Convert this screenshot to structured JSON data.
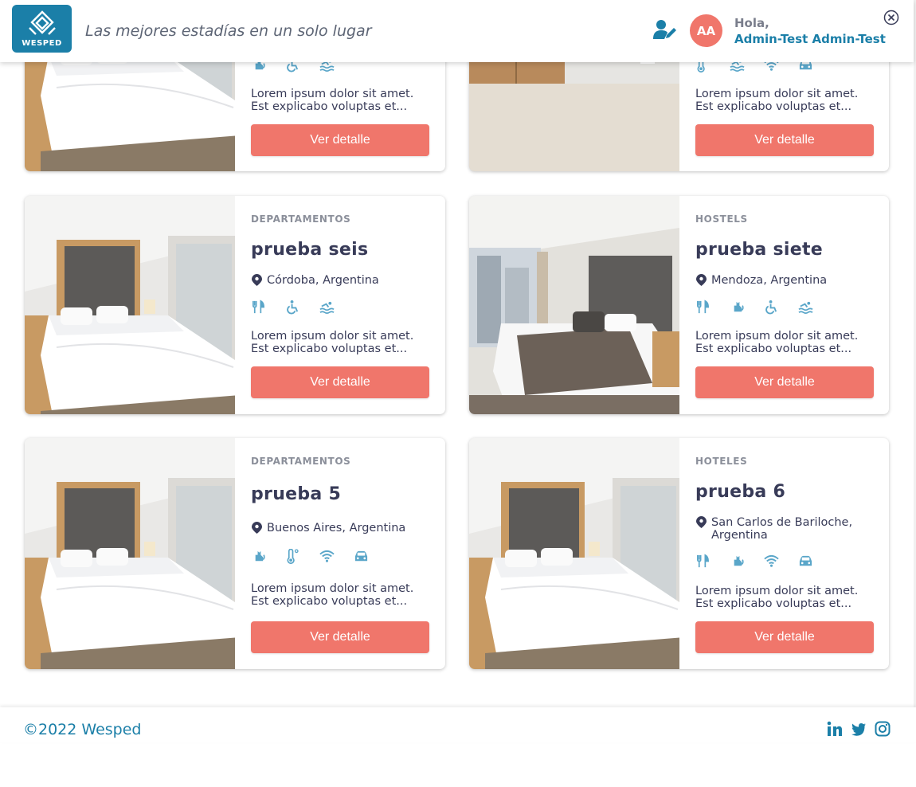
{
  "header": {
    "logo_text": "WESPED",
    "slogan": "Las mejores estadías en un solo lugar",
    "avatar_initials": "AA",
    "greeting": "Hola,",
    "username": "Admin-Test Admin-Test"
  },
  "cards": [
    {
      "category": "",
      "title": "",
      "location": "",
      "amenities": [
        "cat-icon",
        "wheelchair-icon",
        "pool-icon"
      ],
      "description": "Lorem ipsum dolor sit amet. Est explicabo voluptas et...",
      "button": "Ver detalle"
    },
    {
      "category": "",
      "title": "",
      "location": "",
      "amenities": [
        "thermometer-icon",
        "pool-icon",
        "wifi-icon",
        "car-icon"
      ],
      "description": "Lorem ipsum dolor sit amet. Est explicabo voluptas et...",
      "button": "Ver detalle"
    },
    {
      "category": "DEPARTAMENTOS",
      "title": "prueba seis",
      "location": "Córdoba, Argentina",
      "amenities": [
        "fork-knife-icon",
        "wheelchair-icon",
        "pool-icon"
      ],
      "description": "Lorem ipsum dolor sit amet. Est explicabo voluptas et...",
      "button": "Ver detalle"
    },
    {
      "category": "HOSTELS",
      "title": "prueba siete",
      "location": "Mendoza, Argentina",
      "amenities": [
        "fork-knife-icon",
        "cat-icon",
        "wheelchair-icon",
        "pool-icon"
      ],
      "description": "Lorem ipsum dolor sit amet. Est explicabo voluptas et...",
      "button": "Ver detalle"
    },
    {
      "category": "DEPARTAMENTOS",
      "title": "prueba 5",
      "location": "Buenos Aires, Argentina",
      "amenities": [
        "cat-icon",
        "thermometer-icon",
        "wifi-icon",
        "car-icon"
      ],
      "description": "Lorem ipsum dolor sit amet. Est explicabo voluptas et...",
      "button": "Ver detalle"
    },
    {
      "category": "HOTELES",
      "title": "prueba 6",
      "location": "San Carlos de Bariloche, Argentina",
      "amenities": [
        "fork-knife-icon",
        "cat-icon",
        "wifi-icon",
        "car-icon"
      ],
      "description": "Lorem ipsum dolor sit amet. Est explicabo voluptas et...",
      "button": "Ver detalle"
    }
  ],
  "footer": {
    "copyright": "©2022 Wesped",
    "social": [
      "linkedin-icon",
      "twitter-icon",
      "instagram-icon"
    ]
  },
  "colors": {
    "brand_blue": "#1b7fa8",
    "accent_coral": "#f0766b",
    "amenity_blue": "#5aa6c9",
    "text_dark": "#383b58"
  }
}
